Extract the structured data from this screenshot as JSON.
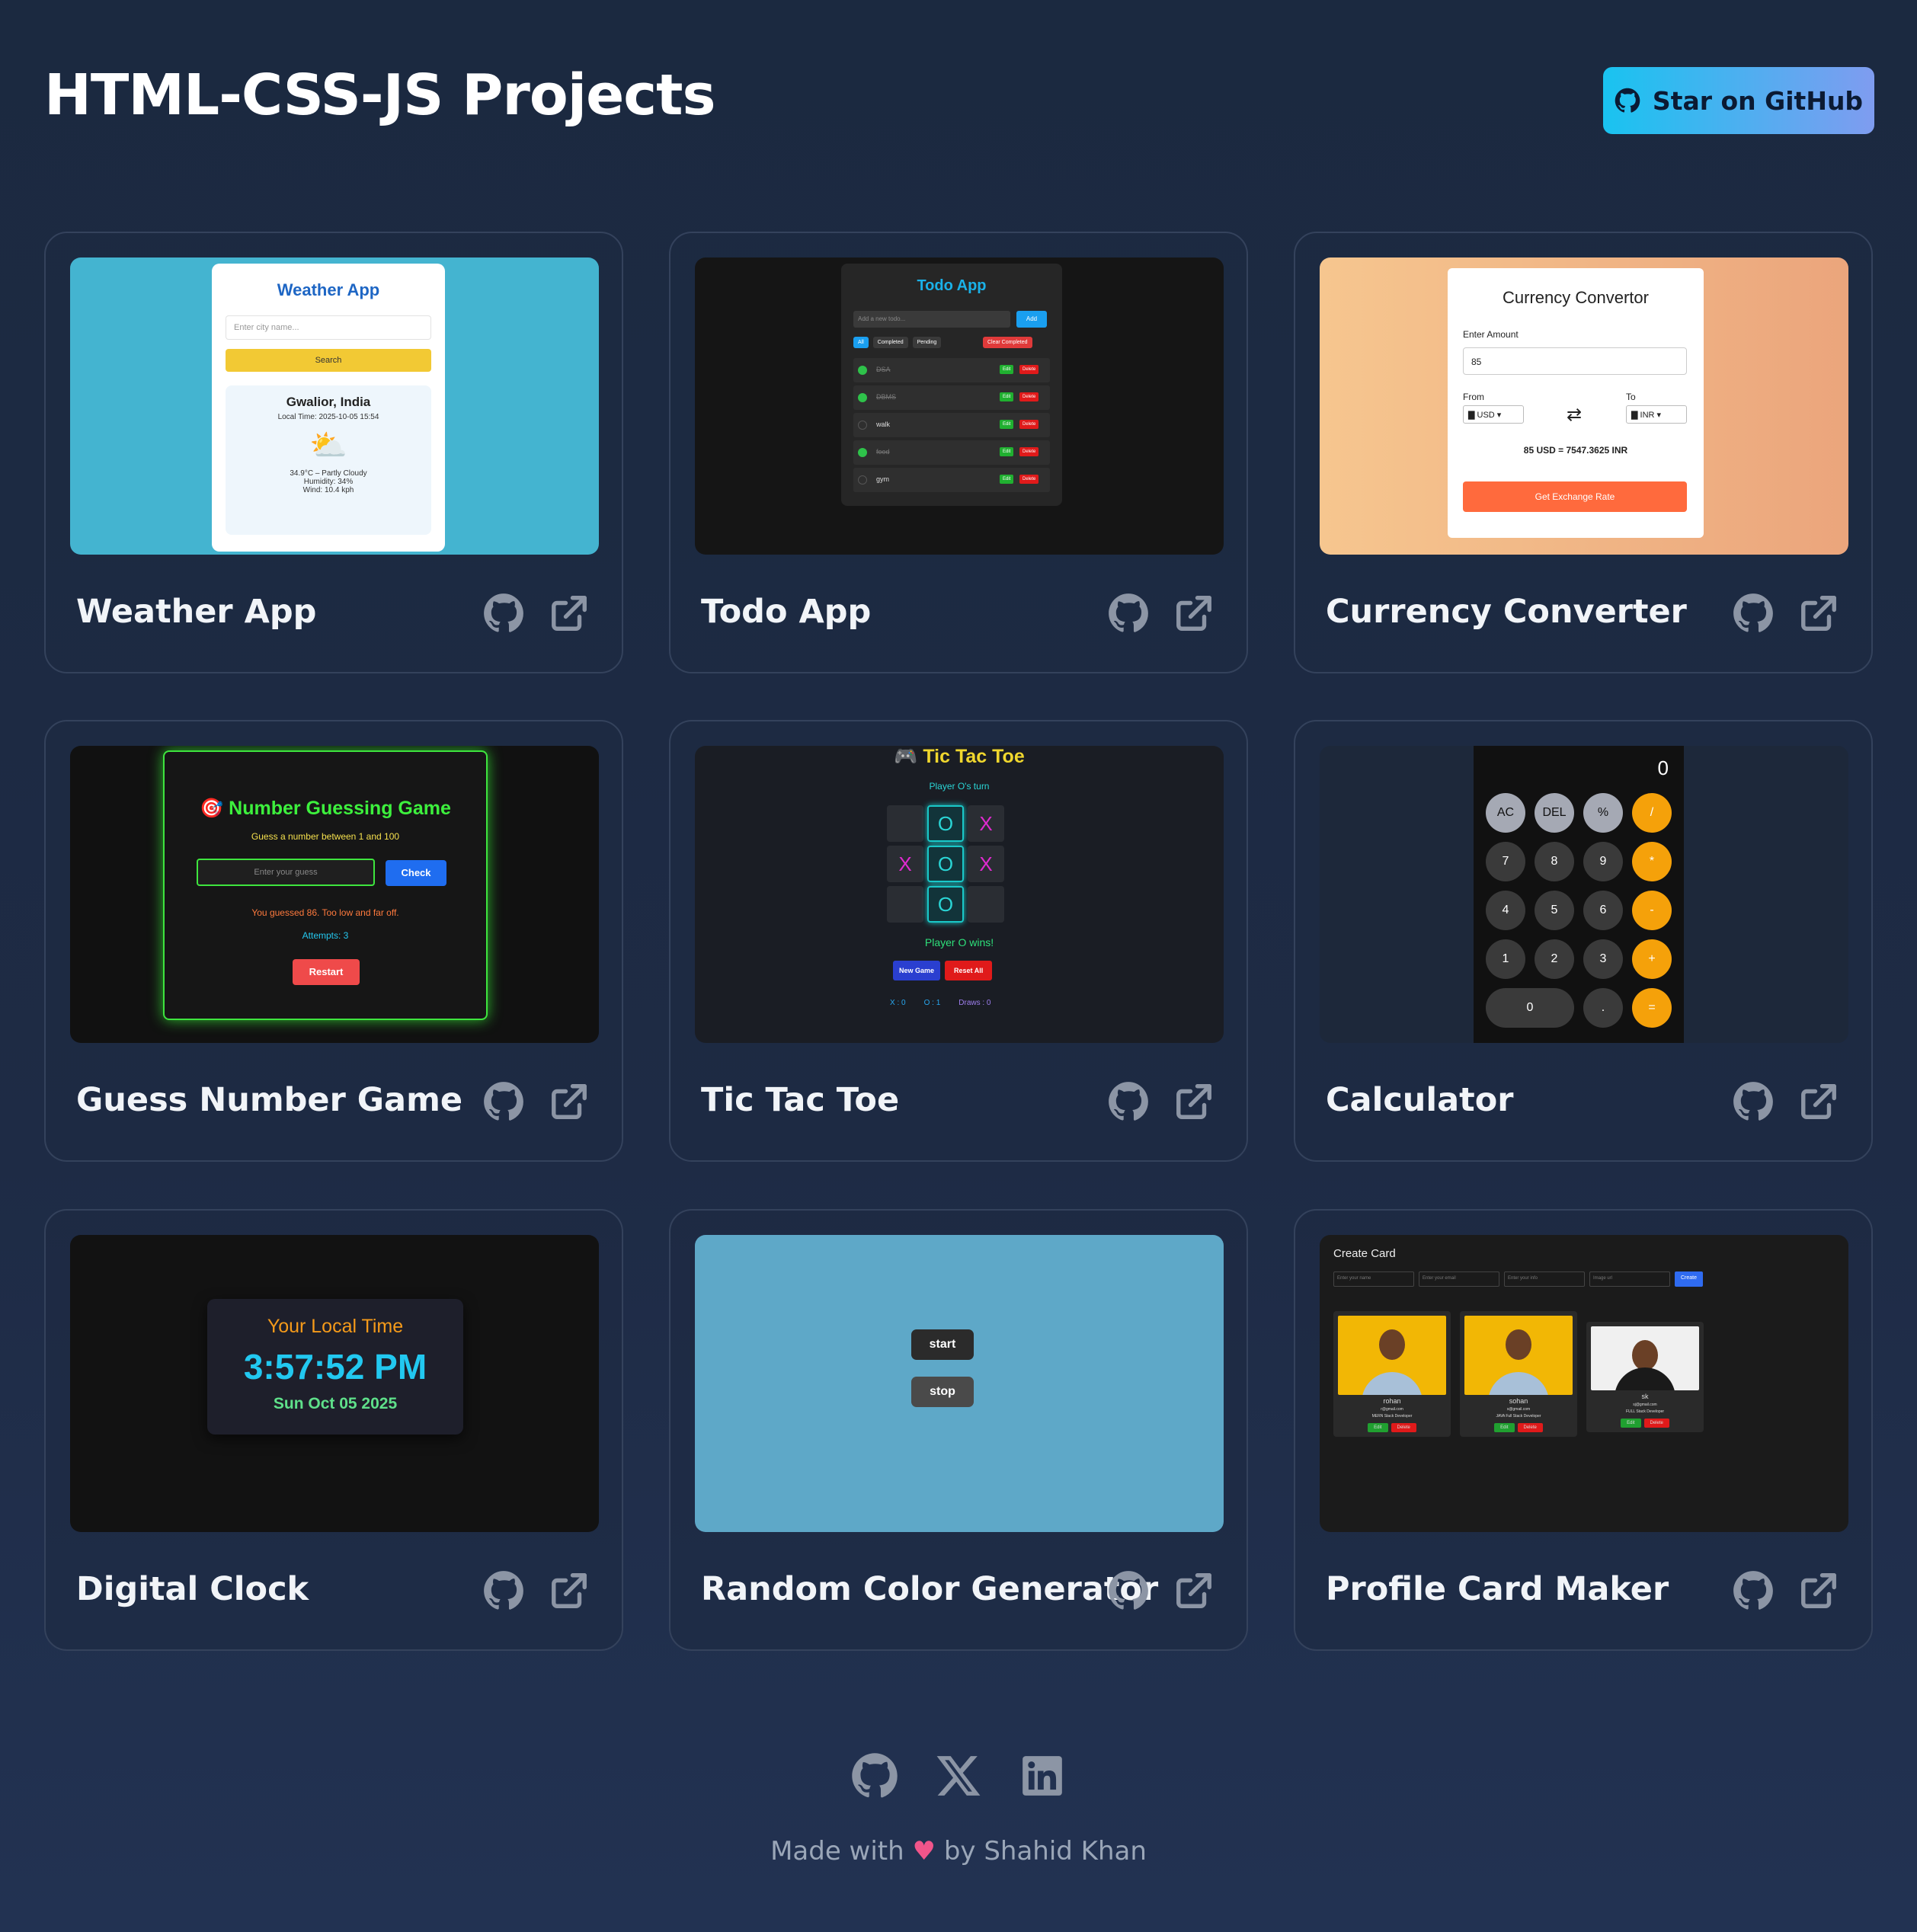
{
  "header": {
    "title": "HTML-CSS-JS Projects",
    "star_label": "Star on GitHub"
  },
  "projects": [
    {
      "title": "Weather App"
    },
    {
      "title": "Todo App"
    },
    {
      "title": "Currency Converter"
    },
    {
      "title": "Guess Number Game"
    },
    {
      "title": "Tic Tac Toe"
    },
    {
      "title": "Calculator"
    },
    {
      "title": "Digital Clock"
    },
    {
      "title": "Random Color Generator"
    },
    {
      "title": "Profile Card Maker"
    }
  ],
  "previews": {
    "weather": {
      "title": "Weather App",
      "placeholder": "Enter city name...",
      "search": "Search",
      "city": "Gwalior, India",
      "local_time": "Local Time: 2025-10-05 15:54",
      "temp": "34.9°C – Partly Cloudy",
      "humidity": "Humidity: 34%",
      "wind": "Wind: 10.4 kph"
    },
    "todo": {
      "title": "Todo App",
      "placeholder": "Add a new todo...",
      "add": "Add",
      "filters": [
        "All",
        "Completed",
        "Pending"
      ],
      "clear": "Clear Completed",
      "items": [
        {
          "text": "DSA",
          "done": true
        },
        {
          "text": "DBMS",
          "done": true
        },
        {
          "text": "walk",
          "done": false
        },
        {
          "text": "food",
          "done": true
        },
        {
          "text": "gym",
          "done": false
        }
      ],
      "edit": "Edit",
      "delete": "Delete"
    },
    "currency": {
      "title": "Currency Convertor",
      "amount_label": "Enter Amount",
      "amount": "85",
      "from_label": "From",
      "to_label": "To",
      "from": "USD",
      "to": "INR",
      "result": "85 USD = 7547.3625 INR",
      "button": "Get Exchange Rate"
    },
    "guess": {
      "title": "Number Guessing Game",
      "subtitle": "Guess a number between 1 and 100",
      "placeholder": "Enter your guess",
      "check": "Check",
      "message": "You guessed 86. Too low and far off.",
      "attempts": "Attempts: 3",
      "restart": "Restart"
    },
    "ttt": {
      "title": "Tic Tac Toe",
      "turn": "Player O's turn",
      "board": [
        "",
        "O",
        "X",
        "X",
        "O",
        "X",
        "",
        "O",
        ""
      ],
      "result": "Player O wins!",
      "new_game": "New Game",
      "reset": "Reset All",
      "x_score": "X : 0",
      "o_score": "O : 1",
      "draws": "Draws : 0"
    },
    "calc": {
      "display": "0",
      "keys": [
        "AC",
        "DEL",
        "%",
        "/",
        "7",
        "8",
        "9",
        "*",
        "4",
        "5",
        "6",
        "-",
        "1",
        "2",
        "3",
        "+",
        "0",
        ".",
        "="
      ]
    },
    "clock": {
      "label": "Your Local Time",
      "time": "3:57:52 PM",
      "date": "Sun Oct 05 2025"
    },
    "color": {
      "start": "start",
      "stop": "stop"
    },
    "profile": {
      "title": "Create Card",
      "inputs": [
        "Enter your name",
        "Enter your email",
        "Enter your info",
        "Image url"
      ],
      "create": "Create",
      "cards": [
        {
          "name": "rohan",
          "email": "r@gmail.com",
          "role": "MERN Stack Developer"
        },
        {
          "name": "sohan",
          "email": "s@gmail.com",
          "role": "JAVA Full Stack Developer"
        },
        {
          "name": "sk",
          "email": "sj@gmail.com",
          "role": "FULL Stack Developer"
        }
      ],
      "edit": "Edit",
      "delete": "Delete"
    }
  },
  "footer": {
    "made_with": "Made with",
    "by": "by Shahid Khan",
    "heart": "♥"
  },
  "colors": {
    "accent_start": "#19c3f0",
    "accent_end": "#7f9cf0",
    "bg": "#1b2940"
  }
}
